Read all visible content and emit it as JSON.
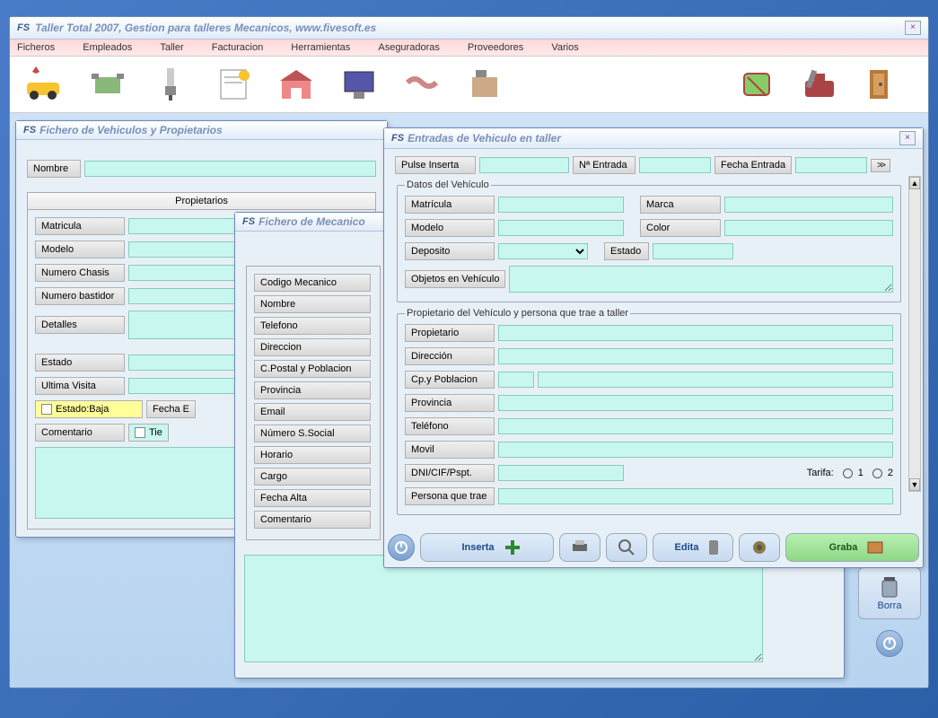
{
  "app": {
    "title": "Taller Total 2007, Gestion para talleres Mecanicos, www.fivesoft.es"
  },
  "menu": [
    "Ficheros",
    "Empleados",
    "Taller",
    "Facturacion",
    "Herramientas",
    "Aseguradoras",
    "Proveedores",
    "Varios"
  ],
  "win_vehiculos": {
    "title": "Fichero de Vehiculos y Propietarios",
    "nombre_lbl": "Nombre",
    "tab": "Propietarios",
    "fields": {
      "matricula": "Matricula",
      "modelo": "Modelo",
      "numero_chasis": "Numero Chasis",
      "numero_bastidor": "Numero bastidor",
      "detalles": "Detalles",
      "estado": "Estado",
      "ultima_visita": "Ultima Visita",
      "estado_baja": "Estado:Baja",
      "fecha_e": "Fecha E",
      "comentario": "Comentario",
      "tie": "Tie"
    }
  },
  "win_mecanicos": {
    "title": "Fichero de Mecanico",
    "fields": {
      "codigo_mecanico": "Codigo Mecanico",
      "nombre": "Nombre",
      "telefono": "Telefono",
      "direccion": "Direccion",
      "cpostal": "C.Postal y Poblacion",
      "provincia": "Provincia",
      "email": "Email",
      "nss": "Número S.Social",
      "horario": "Horario",
      "cargo": "Cargo",
      "fecha_alta": "Fecha Alta",
      "comentario": "Comentario"
    },
    "borra": "Borra"
  },
  "win_entradas": {
    "title": "Entradas de Vehiculo en taller",
    "top": {
      "pulse": "Pulse Inserta",
      "n_entrada": "Nª Entrada",
      "fecha_entrada": "Fecha Entrada",
      "arrows": ">>"
    },
    "grp_vehiculo": {
      "legend": "Datos del Vehículo",
      "matricula": "Matrícula",
      "marca": "Marca",
      "modelo": "Modelo",
      "color": "Color",
      "deposito": "Deposito",
      "estado": "Estado",
      "objetos": "Objetos en Vehículo"
    },
    "grp_prop": {
      "legend": "Propietario del Vehículo y persona que trae a taller",
      "propietario": "Propietario",
      "direccion": "Dirección",
      "cp": "Cp.y Poblacion",
      "provincia": "Provincia",
      "telefono": "Teléfono",
      "movil": "Movil",
      "dni": "DNI/CIF/Pspt.",
      "tarifa": "Tarifa:",
      "t1": "1",
      "t2": "2",
      "persona": "Persona que trae"
    },
    "actions": {
      "inserta": "Inserta",
      "edita": "Edita",
      "graba": "Graba"
    }
  }
}
